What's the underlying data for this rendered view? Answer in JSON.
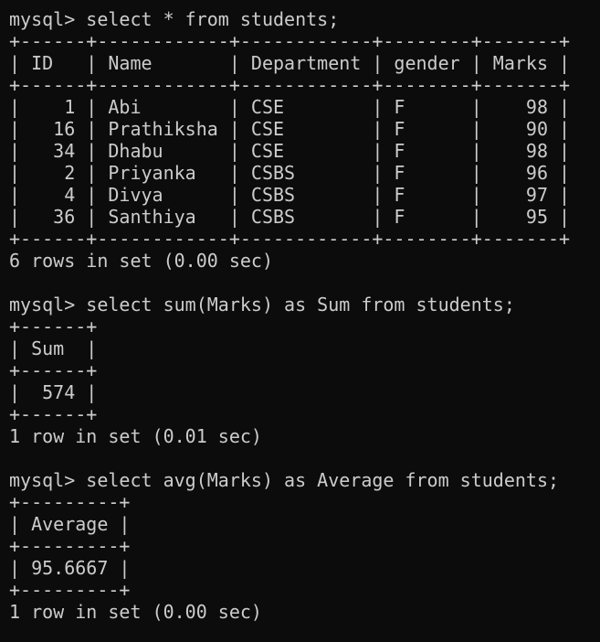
{
  "terminal": {
    "query1": {
      "command": "mysql> select * from students;",
      "border": "+------+------------+------------+--------+-------+",
      "header": "| ID   | Name       | Department | gender | Marks |",
      "rows": [
        "|    1 | Abi        | CSE        | F      |    98 |",
        "|   16 | Prathiksha | CSE        | F      |    90 |",
        "|   34 | Dhabu      | CSE        | F      |    98 |",
        "|    2 | Priyanka   | CSBS       | F      |    96 |",
        "|    4 | Divya      | CSBS       | F      |    97 |",
        "|   36 | Santhiya   | CSBS       | F      |    95 |"
      ],
      "status": "6 rows in set (0.00 sec)"
    },
    "query2": {
      "command": "mysql> select sum(Marks) as Sum from students;",
      "border": "+------+",
      "header": "| Sum  |",
      "row": "|  574 |",
      "status": "1 row in set (0.01 sec)"
    },
    "query3": {
      "command": "mysql> select avg(Marks) as Average from students;",
      "border": "+---------+",
      "header": "| Average |",
      "row": "| 95.6667 |",
      "status": "1 row in set (0.00 sec)"
    }
  }
}
